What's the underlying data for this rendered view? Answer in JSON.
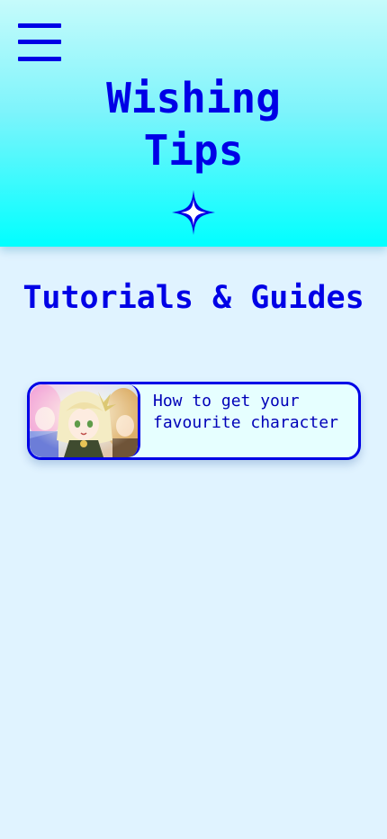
{
  "header": {
    "menu_icon": "hamburger-menu-icon",
    "title": "Wishing\nTips",
    "sparkle_icon": "four-point-star-icon"
  },
  "main": {
    "section_title": "Tutorials & Guides",
    "guides": [
      {
        "title": "How to get your\nfavourite character",
        "thumbnail": "character-artwork-thumbnail"
      }
    ]
  },
  "colors": {
    "accent": "#0000e6",
    "header_top": "#c6fbfb",
    "header_bottom": "#00ffff",
    "page_background": "#e0f3ff",
    "card_background": "#e6ffff"
  }
}
